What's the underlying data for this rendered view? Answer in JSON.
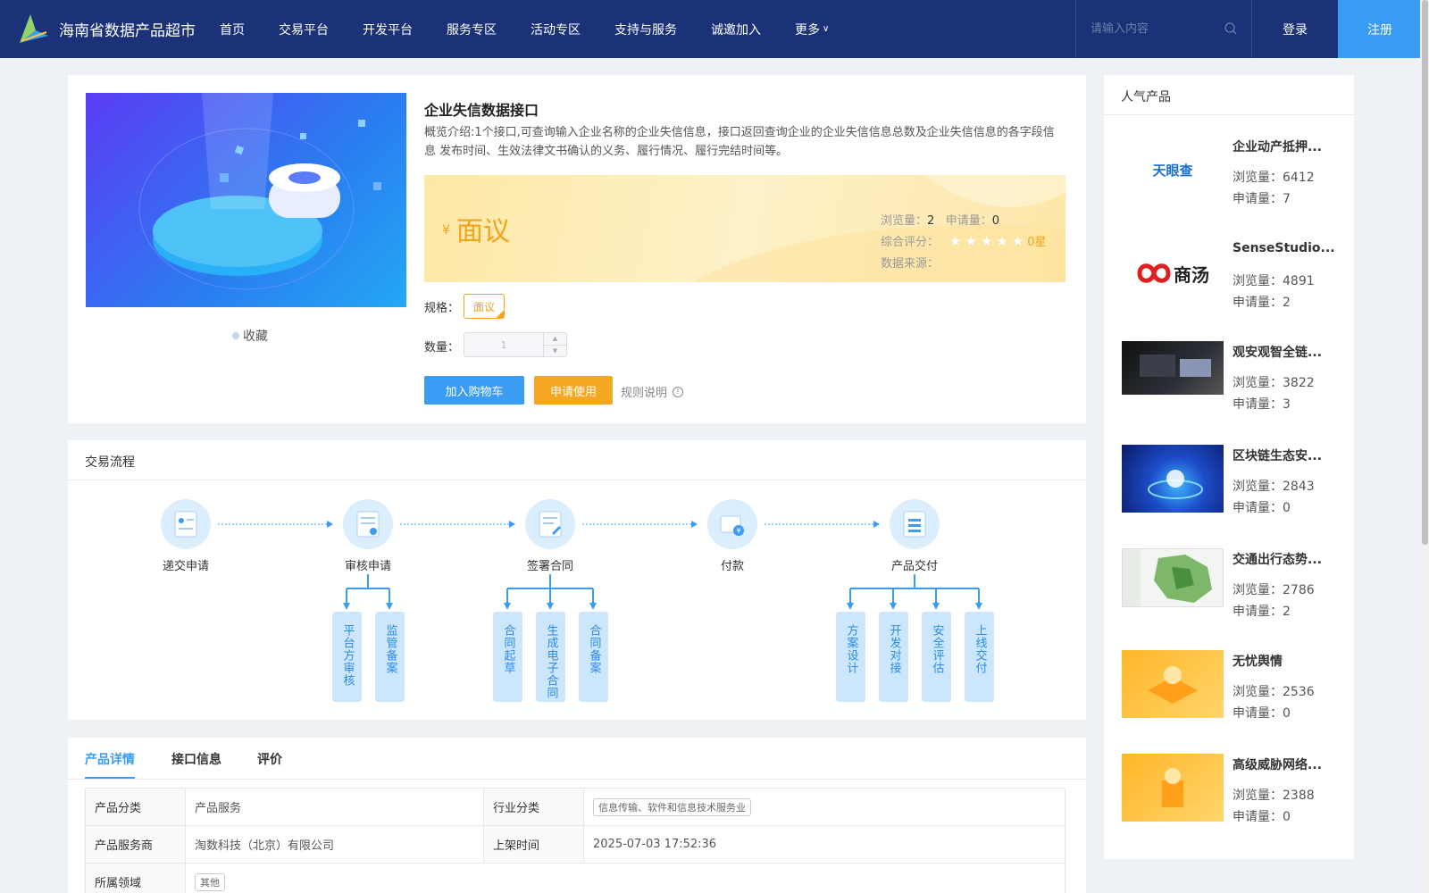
{
  "header": {
    "brand": "海南省数据产品超市",
    "nav": [
      "首页",
      "交易平台",
      "开发平台",
      "服务专区",
      "活动专区",
      "支持与服务",
      "诚邀加入",
      "更多"
    ],
    "search_placeholder": "请输入内容",
    "login": "登录",
    "register": "注册"
  },
  "product": {
    "title": "企业失信数据接口",
    "description": "概览介绍:1个接口,可查询输入企业名称的企业失信信息，接口返回查询企业的企业失信信息总数及企业失信信息的各字段信息 发布时间、生效法律文书确认的义务、履行情况、履行完结时间等。",
    "price_symbol": "¥",
    "price": "面议",
    "views_label": "浏览量：",
    "views": "2",
    "applies_label": "申请量：",
    "applies": "0",
    "rating_label": "综合评分：",
    "rating": "0星",
    "rating_value": 0,
    "source_label": "数据来源：",
    "favorite": "收藏",
    "spec_label": "规格：",
    "spec_value": "面议",
    "qty_label": "数量：",
    "qty_value": "1",
    "add_cart": "加入购物车",
    "apply": "申请使用",
    "rules": "规则说明"
  },
  "flow": {
    "title": "交易流程",
    "steps": [
      "递交申请",
      "审核申请",
      "签署合同",
      "付款",
      "产品交付"
    ],
    "sub_review": [
      "平台方审核",
      "监管备案"
    ],
    "sub_contract": [
      "合同起草",
      "生成电子合同",
      "合同备案"
    ],
    "sub_delivery": [
      "方案设计",
      "开发对接",
      "安全评估",
      "上线交付"
    ]
  },
  "details": {
    "tabs": [
      "产品详情",
      "接口信息",
      "评价"
    ],
    "rows": [
      {
        "k1": "产品分类",
        "v1": "产品服务",
        "k2": "行业分类",
        "v2": "信息传输、软件和信息技术服务业"
      },
      {
        "k1": "产品服务商",
        "v1": "淘数科技（北京）有限公司",
        "k2": "上架时间",
        "v2": "2025-07-03 17:52:36"
      },
      {
        "k1": "所属领域",
        "v1": "其他"
      }
    ]
  },
  "sidebar": {
    "title": "人气产品",
    "views_label": "浏览量：",
    "applies_label": "申请量：",
    "items": [
      {
        "name": "企业动产抵押...",
        "views": "6412",
        "applies": "7",
        "thumb_text": "天眼查"
      },
      {
        "name": "SenseStudio...",
        "views": "4891",
        "applies": "2",
        "thumb_text": "商汤"
      },
      {
        "name": "观安观智全链...",
        "views": "3822",
        "applies": "3"
      },
      {
        "name": "区块链生态安...",
        "views": "2843",
        "applies": "0"
      },
      {
        "name": "交通出行态势...",
        "views": "2786",
        "applies": "2"
      },
      {
        "name": "无忧舆情",
        "views": "2536",
        "applies": "0"
      },
      {
        "name": "高级威胁网络...",
        "views": "2388",
        "applies": "0"
      }
    ]
  },
  "colors": {
    "header_bg": "#1b3278",
    "accent_blue": "#3a9cf2",
    "accent_orange": "#f5a623"
  }
}
